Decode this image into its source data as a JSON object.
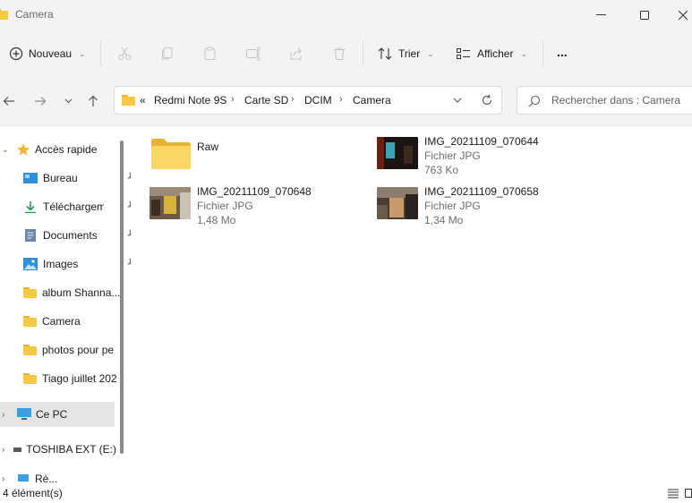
{
  "window": {
    "title": "Camera"
  },
  "toolbar": {
    "new_label": "Nouveau",
    "sort_label": "Trier",
    "view_label": "Afficher",
    "more_label": "..."
  },
  "address": {
    "overflow": "«",
    "crumbs": [
      "Redmi Note 9S",
      "Carte SD",
      "DCIM",
      "Camera"
    ]
  },
  "search": {
    "placeholder": "Rechercher dans : Camera"
  },
  "sidebar": {
    "quick_access": "Accès rapide",
    "items": [
      {
        "label": "Bureau",
        "icon": "desktop-icon",
        "pinned": true
      },
      {
        "label": "Téléchargements",
        "icon": "download-icon",
        "pinned": true
      },
      {
        "label": "Documents",
        "icon": "documents-icon",
        "pinned": true
      },
      {
        "label": "Images",
        "icon": "images-icon",
        "pinned": true
      },
      {
        "label": "album Shanna...",
        "icon": "folder-icon",
        "pinned": false
      },
      {
        "label": "Camera",
        "icon": "folder-icon",
        "pinned": false
      },
      {
        "label": "photos pour pe",
        "icon": "folder-icon",
        "pinned": false
      },
      {
        "label": "Tiago juillet 202",
        "icon": "folder-icon",
        "pinned": false
      }
    ],
    "this_pc": "Ce PC",
    "drive": "TOSHIBA EXT (E:)",
    "network": "Ré..."
  },
  "files": [
    {
      "name": "Raw",
      "type": "",
      "size": "",
      "kind": "folder"
    },
    {
      "name": "IMG_20211109_070644",
      "type": "Fichier JPG",
      "size": "763 Ko",
      "kind": "image"
    },
    {
      "name": "IMG_20211109_070648",
      "type": "Fichier JPG",
      "size": "1,48 Mo",
      "kind": "image"
    },
    {
      "name": "IMG_20211109_070658",
      "type": "Fichier JPG",
      "size": "1,34 Mo",
      "kind": "image"
    }
  ],
  "status": {
    "count": "4 élément(s)"
  },
  "colors": {
    "folder": "#f6c945",
    "selection": "#e5e5e5",
    "accent": "#0067c0"
  }
}
